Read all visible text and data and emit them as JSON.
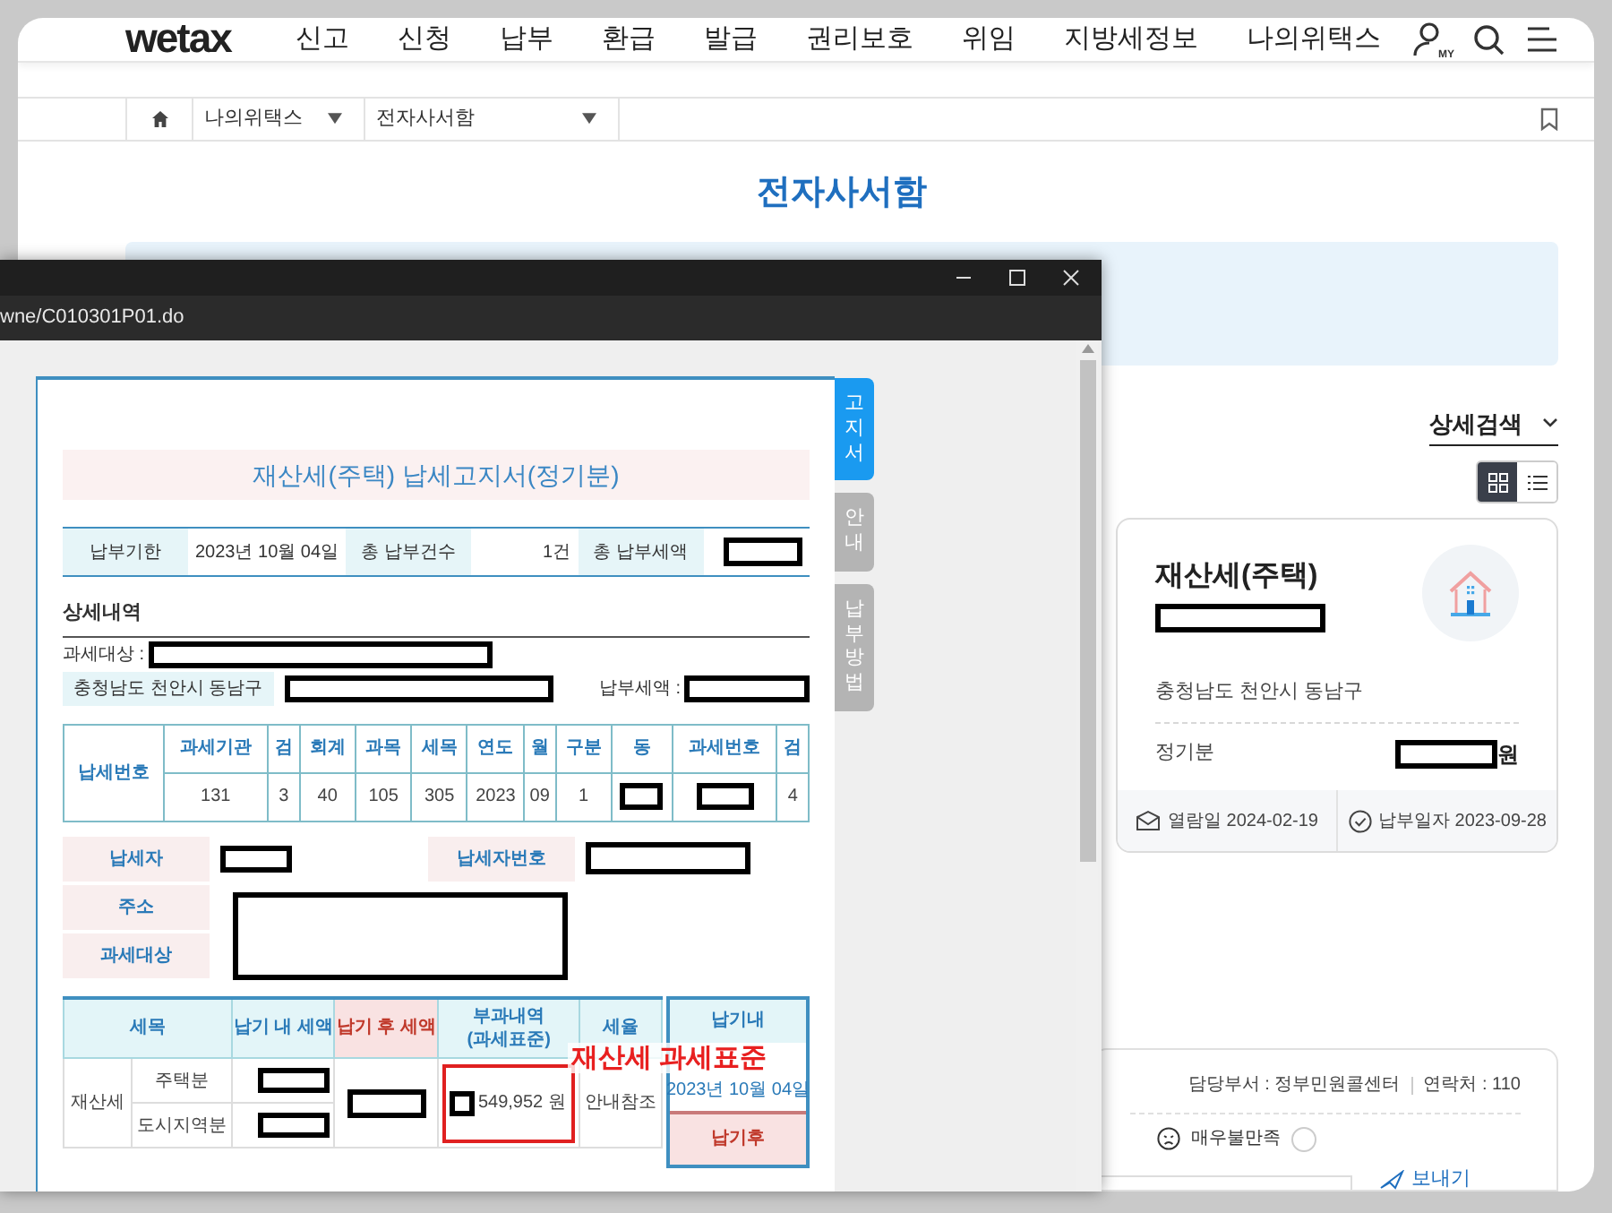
{
  "header": {
    "logo": "wetax",
    "nav": [
      "신고",
      "신청",
      "납부",
      "환급",
      "발급",
      "권리보호",
      "위임",
      "지방세정보",
      "나의위택스"
    ],
    "my_badge": "MY"
  },
  "breadcrumb": [
    "나의위택스",
    "전자사서함"
  ],
  "page_title": "전자사서함",
  "search_filter": {
    "label": "상세검색"
  },
  "view_toggle": [
    {
      "kind": "grid",
      "selected": true
    },
    {
      "kind": "list",
      "selected": false
    }
  ],
  "notice_card": {
    "title": "재산세(주택)",
    "address": "충청남도 천안시 동남구",
    "period": "정기분",
    "amount_unit": "원",
    "view_date": "열람일 2024-02-19",
    "pay_date": "납부일자 2023-09-28"
  },
  "feedback": {
    "department": "담당부서 : 정부민원콜센터",
    "contact": "연락처 : 110",
    "rating_options": [
      {
        "label": "매우불만족",
        "selected": false
      }
    ],
    "send_button": "보내기"
  },
  "popup": {
    "url": "wne/C010301P01.do",
    "side_tabs": [
      {
        "label": "고지서",
        "selected": true
      },
      {
        "label": "안내",
        "selected": false
      },
      {
        "label": "납부방법",
        "selected": false
      }
    ],
    "document": {
      "title": "재산세(주택) 납세고지서(정기분)",
      "summary": [
        {
          "label": "납부기한",
          "value": "2023년 10월 04일",
          "redacted": false
        },
        {
          "label": "총 납부건수",
          "value": "1건",
          "redacted": false
        },
        {
          "label": "총 납부세액",
          "redacted": true
        }
      ],
      "section_title": "상세내역",
      "target_label": "과세대상 :",
      "address": "충청남도 천안시 동남구",
      "tax_amount_label": "납부세액 :",
      "tax_number": {
        "label": "납세번호",
        "columns": [
          "과세기관",
          "검",
          "회계",
          "과목",
          "세목",
          "연도",
          "월",
          "구분",
          "동",
          "과세번호",
          "검"
        ],
        "values": [
          {
            "text": "131",
            "redacted": false
          },
          {
            "text": "3",
            "redacted": false
          },
          {
            "text": "40",
            "redacted": false
          },
          {
            "text": "105",
            "redacted": false
          },
          {
            "text": "305",
            "redacted": false
          },
          {
            "text": "2023",
            "redacted": false
          },
          {
            "text": "09",
            "redacted": false
          },
          {
            "text": "1",
            "redacted": false
          },
          {
            "redacted": true
          },
          {
            "redacted": true
          },
          {
            "text": "4",
            "redacted": false
          }
        ]
      },
      "taxpayer": [
        "납세자",
        "납세자번호",
        "주소",
        "과세대상"
      ],
      "breakdown": {
        "columns": [
          {
            "label": "세목",
            "kind": "normal"
          },
          {
            "label": "납기 내 세액",
            "kind": "normal"
          },
          {
            "label": "납기 후 세액",
            "kind": "late"
          },
          {
            "label": "부과내역",
            "sublabel": "(과세표준)",
            "kind": "normal"
          },
          {
            "label": "세율",
            "kind": "normal"
          }
        ],
        "tax_name": "재산세",
        "rows": [
          "주택분",
          "도시지역분"
        ],
        "base": "549,952 원",
        "rate": "안내참조",
        "due_box": {
          "header": "납기내",
          "date": "2023년 10월 04일",
          "late_header": "납기후"
        }
      },
      "annotation": "재산세 과세표준"
    }
  }
}
